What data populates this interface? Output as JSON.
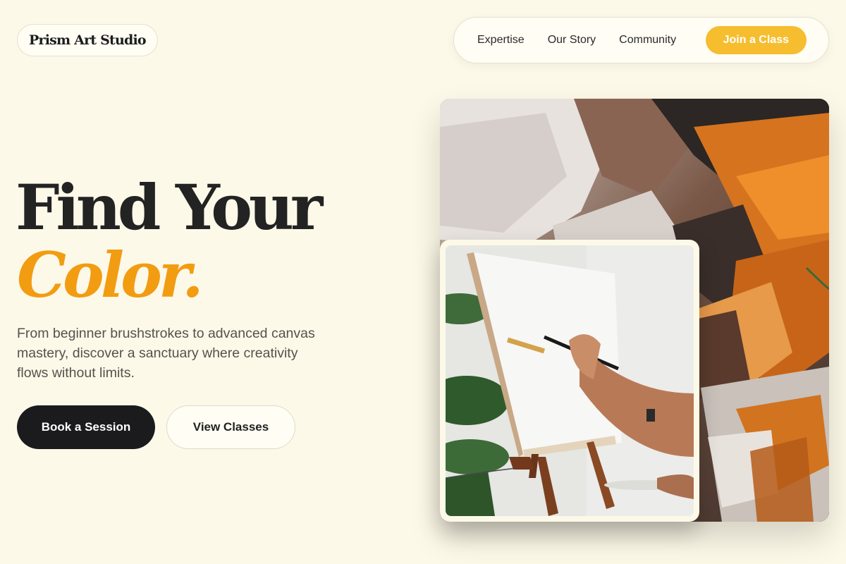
{
  "brand": {
    "name": "Prism Art Studio"
  },
  "nav": {
    "links": [
      "Expertise",
      "Our Story",
      "Community"
    ],
    "cta_label": "Join a Class"
  },
  "hero": {
    "title_line1": "Find Your",
    "title_accent": "Color.",
    "description": "From beginner brushstrokes to advanced canvas mastery, discover a sanctuary where creativity flows without limits.",
    "primary_button": "Book a Session",
    "secondary_button": "View Classes"
  },
  "images": {
    "main_image": "abstract-impasto-paint-texture",
    "inset_image": "hand-painting-on-easel-canvas"
  },
  "colors": {
    "background": "#fdf9e8",
    "accent": "#f29c12",
    "cta_yellow": "#f6bd2e",
    "dark_button": "#1b1b1d"
  }
}
